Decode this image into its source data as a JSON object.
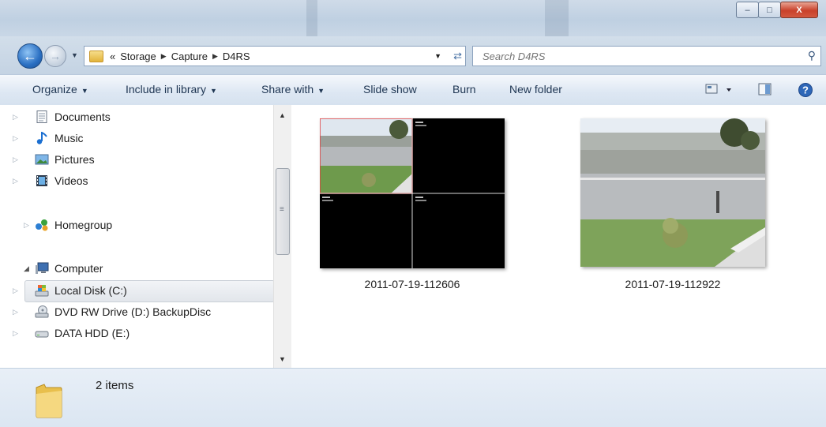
{
  "window": {
    "title_buttons": {
      "minimize": "–",
      "maximize": "□",
      "close": "X"
    }
  },
  "address": {
    "overflow": "«",
    "breadcrumbs": [
      "Storage",
      "Capture",
      "D4RS"
    ]
  },
  "search": {
    "placeholder": "Search D4RS"
  },
  "toolbar": {
    "organize": "Organize",
    "include_in_library": "Include in library",
    "share_with": "Share with",
    "slide_show": "Slide show",
    "burn": "Burn",
    "new_folder": "New folder"
  },
  "nav": {
    "documents": "Documents",
    "music": "Music",
    "pictures": "Pictures",
    "videos": "Videos",
    "homegroup": "Homegroup",
    "computer": "Computer",
    "local_disk": "Local Disk (C:)",
    "dvd_drive": "DVD RW Drive (D:) BackupDisc",
    "data_hdd": "DATA HDD (E:)"
  },
  "files": [
    {
      "name": "2011-07-19-112606"
    },
    {
      "name": "2011-07-19-112922"
    }
  ],
  "details": {
    "item_count": "2 items"
  },
  "colors": {
    "accent": "#2a6fc2",
    "folder": "#e8bf4c",
    "close": "#c9412a"
  }
}
